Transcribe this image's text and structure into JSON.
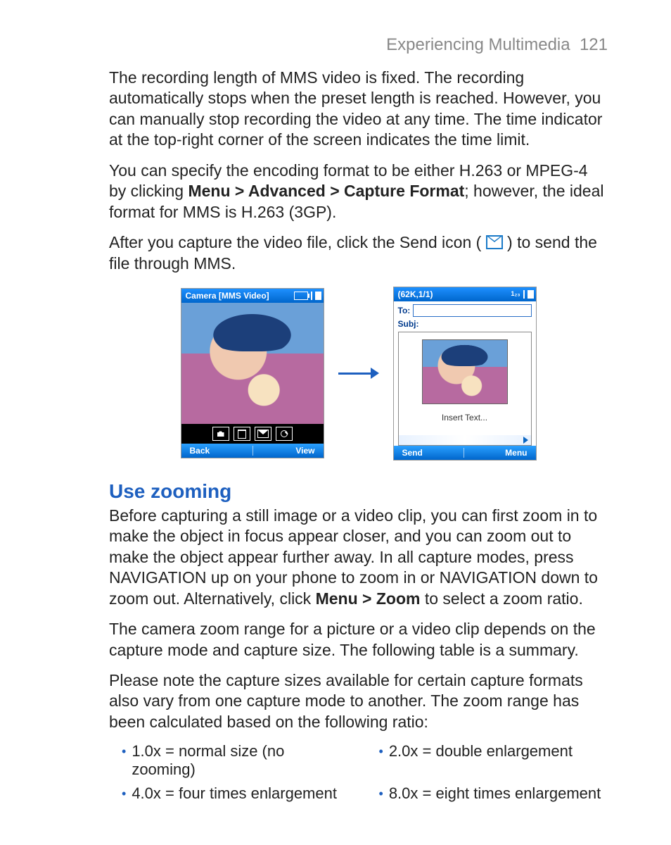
{
  "header": {
    "chapter": "Experiencing Multimedia",
    "page": "121"
  },
  "para1": "The recording length of MMS video is fixed. The recording automatically stops when the preset length is reached. However, you can manually stop recording the video at any time. The time indicator at the top-right corner of the screen indicates the time limit.",
  "para2_a": "You can specify the encoding format to be either H.263 or MPEG-4 by clicking ",
  "para2_b": "Menu > Advanced > Capture Format",
  "para2_c": "; however, the ideal format for MMS is H.263 (3GP).",
  "para3_a": "After you capture the video file, click the Send icon ( ",
  "para3_b": " ) to send the file through MMS.",
  "screens": {
    "left": {
      "title": "Camera [MMS Video]",
      "soft_left": "Back",
      "soft_right": "View"
    },
    "right": {
      "title": "(62K,1/1)",
      "to_label": "To:",
      "subj_label": "Subj:",
      "insert": "Insert Text...",
      "soft_left": "Send",
      "soft_right": "Menu"
    }
  },
  "section_title": "Use zooming",
  "para4_a": "Before capturing a still image or a video clip, you can first zoom in to make the object in focus appear closer, and you can zoom out to make the object appear further away. In all capture modes, press NAVIGATION up on your phone to zoom in or NAVIGATION down to zoom out. Alternatively, click ",
  "para4_b": "Menu > Zoom",
  "para4_c": " to select a zoom ratio.",
  "para5": "The camera zoom range for a picture or a video clip depends on the capture mode and capture size. The following table is a summary.",
  "para6": "Please note the capture sizes available for certain capture formats also vary from one capture mode to another. The zoom range has been calculated based on the following ratio:",
  "bullets": [
    "1.0x = normal size (no zooming)",
    "2.0x = double enlargement",
    "4.0x = four times enlargement",
    "8.0x = eight times enlargement"
  ]
}
